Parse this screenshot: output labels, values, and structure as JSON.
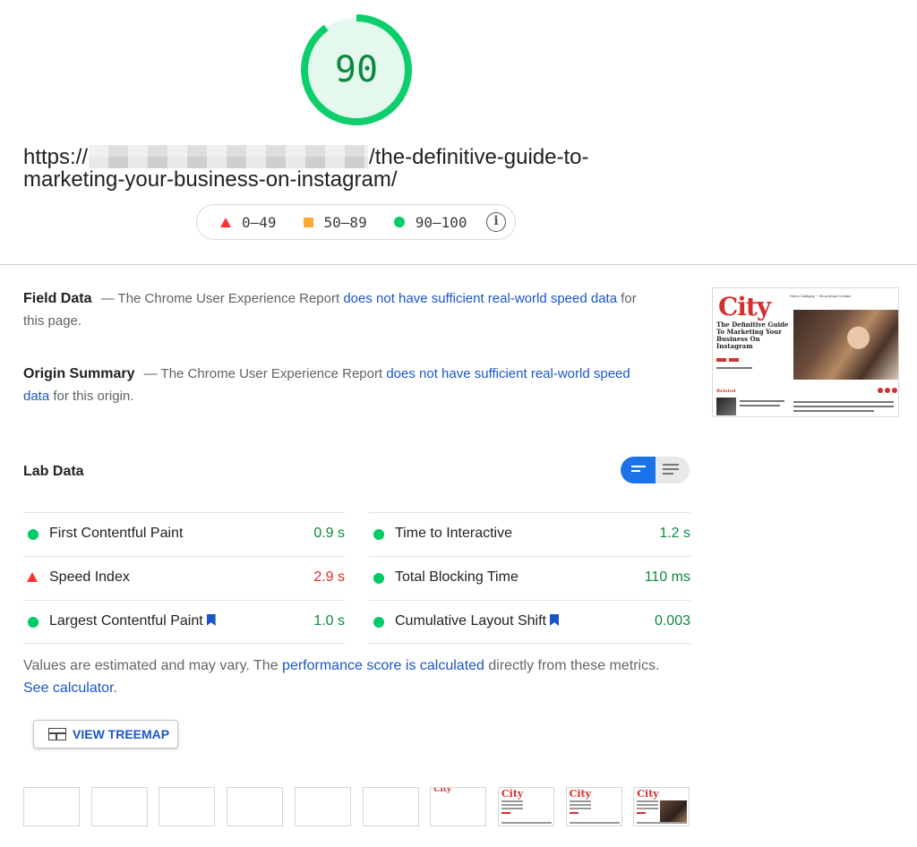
{
  "score": {
    "value": "90",
    "fraction": 0.9,
    "ring_color": "#0cce6b",
    "fill_color": "#e5f8ee",
    "text_color": "#0b8a3e"
  },
  "url": {
    "prefix": "https://",
    "path_line1": "/the-definitive-guide-to-",
    "path_line2": "marketing-your-business-on-instagram/"
  },
  "legend": {
    "items": [
      {
        "shape": "triangle",
        "label": "0–49",
        "color": "#ff3333"
      },
      {
        "shape": "square",
        "label": "50–89",
        "color": "#ffaa33"
      },
      {
        "shape": "circle",
        "label": "90–100",
        "color": "#0cce6b"
      }
    ],
    "info_icon": "info-icon"
  },
  "field_data": {
    "title": "Field Data",
    "text_before": "— The Chrome User Experience Report",
    "link": "does not have sufficient real-world speed data",
    "text_after": "for this page."
  },
  "origin_summary": {
    "title": "Origin Summary",
    "text_before": "— The Chrome User Experience Report",
    "link": "does not have sufficient real-world speed data",
    "text_after": "for this origin."
  },
  "screenshot": {
    "logo": "City",
    "nav": "Home  Category ~  Shop  About  Contact",
    "headline": "The Definitive Guide To Marketing Your Business On Instagram",
    "related_label": "Related",
    "related_item": "How is the Time to Think About Your Small Business Success"
  },
  "lab_data": {
    "title": "Lab Data",
    "toggle": {
      "active": "compact-view-icon",
      "inactive": "detailed-view-icon"
    },
    "metrics_left": [
      {
        "indicator": "circle",
        "name": "First Contentful Paint",
        "value": "0.9 s",
        "status": "good",
        "bookmark": false
      },
      {
        "indicator": "triangle",
        "name": "Speed Index",
        "value": "2.9 s",
        "status": "bad",
        "bookmark": false
      },
      {
        "indicator": "circle",
        "name": "Largest Contentful Paint",
        "value": "1.0 s",
        "status": "good",
        "bookmark": true
      }
    ],
    "metrics_right": [
      {
        "indicator": "circle",
        "name": "Time to Interactive",
        "value": "1.2 s",
        "status": "good",
        "bookmark": false
      },
      {
        "indicator": "circle",
        "name": "Total Blocking Time",
        "value": "110 ms",
        "status": "good",
        "bookmark": false
      },
      {
        "indicator": "circle",
        "name": "Cumulative Layout Shift",
        "value": "0.003",
        "status": "good",
        "bookmark": true
      }
    ]
  },
  "note": {
    "text1": "Values are estimated and may vary. The",
    "link1": "performance score is calculated",
    "text2": "directly from these metrics.",
    "link2": "See calculator",
    "text3": "."
  },
  "treemap_button": {
    "label": "VIEW TREEMAP",
    "icon": "treemap-icon"
  },
  "filmstrip": {
    "frames": [
      {
        "state": "blank"
      },
      {
        "state": "blank"
      },
      {
        "state": "blank"
      },
      {
        "state": "blank"
      },
      {
        "state": "blank"
      },
      {
        "state": "blank"
      },
      {
        "state": "logo-partial",
        "logo": "City"
      },
      {
        "state": "text",
        "logo": "City"
      },
      {
        "state": "text",
        "logo": "City"
      },
      {
        "state": "image",
        "logo": "City"
      }
    ]
  }
}
